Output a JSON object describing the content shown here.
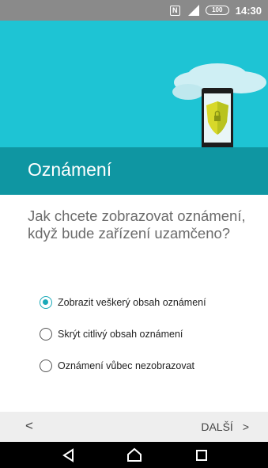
{
  "status_bar": {
    "time": "14:30",
    "battery": "100"
  },
  "header": {
    "title": "Oznámení"
  },
  "question": "Jak chcete zobrazovat oznámení, když bude zařízení uzamčeno?",
  "options": [
    {
      "label": "Zobrazit veškerý obsah oznámení",
      "selected": true
    },
    {
      "label": "Skrýt citlivý obsah oznámení",
      "selected": false
    },
    {
      "label": "Oznámení vůbec nezobrazovat",
      "selected": false
    }
  ],
  "footer": {
    "back_label": "<",
    "next_label": "DALŠÍ",
    "next_arrow": ">"
  },
  "colors": {
    "header_light": "#1ec4d4",
    "header_dark": "#0f96a2",
    "accent": "#19a9b8"
  },
  "icons": [
    "nfc-icon",
    "signal-icon",
    "battery-icon",
    "back-nav-icon",
    "home-nav-icon",
    "recents-nav-icon"
  ]
}
